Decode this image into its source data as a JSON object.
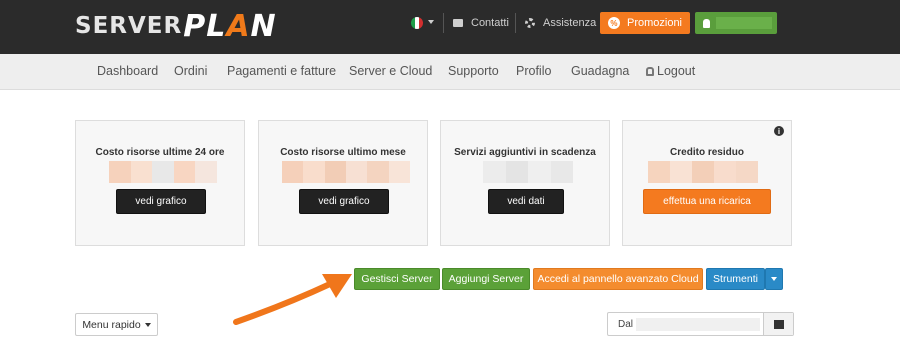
{
  "brand": {
    "part1": "SERVER",
    "part2a": "PL",
    "part2b": "A",
    "part2c": "N"
  },
  "top": {
    "contacts": "Contatti",
    "support": "Assistenza",
    "promo": "Promozioni",
    "promo_icon": "%"
  },
  "nav": [
    {
      "label": "Dashboard"
    },
    {
      "label": "Ordini"
    },
    {
      "label": "Pagamenti e fatture"
    },
    {
      "label": "Server e Cloud"
    },
    {
      "label": "Supporto"
    },
    {
      "label": "Profilo"
    },
    {
      "label": "Guadagna"
    },
    {
      "label": "Logout"
    }
  ],
  "cards": [
    {
      "title": "Costo risorse ultime 24 ore",
      "button": "vedi grafico"
    },
    {
      "title": "Costo risorse ultimo mese",
      "button": "vedi grafico"
    },
    {
      "title": "Servizi aggiuntivi in scadenza",
      "button": "vedi dati"
    },
    {
      "title": "Credito residuo",
      "button": "effettua una ricarica",
      "info": "i"
    }
  ],
  "actions": {
    "manage": "Gestisci Server",
    "add": "Aggiungi Server",
    "cloud": "Accedi al pannello avanzato Cloud",
    "tools": "Strumenti"
  },
  "quick_menu": "Menu rapido",
  "date_filter": {
    "label": "Dal"
  },
  "icons": {
    "flag": "italy-flag-icon",
    "contacts": "envelope-icon",
    "support": "gear-icon",
    "user": "user-icon",
    "lock": "lock-icon",
    "calendar": "calendar-icon"
  },
  "colors": {
    "orange": "#f47a1f",
    "green": "#5ba138",
    "blue": "#2a8ac7",
    "dark": "#222222"
  }
}
